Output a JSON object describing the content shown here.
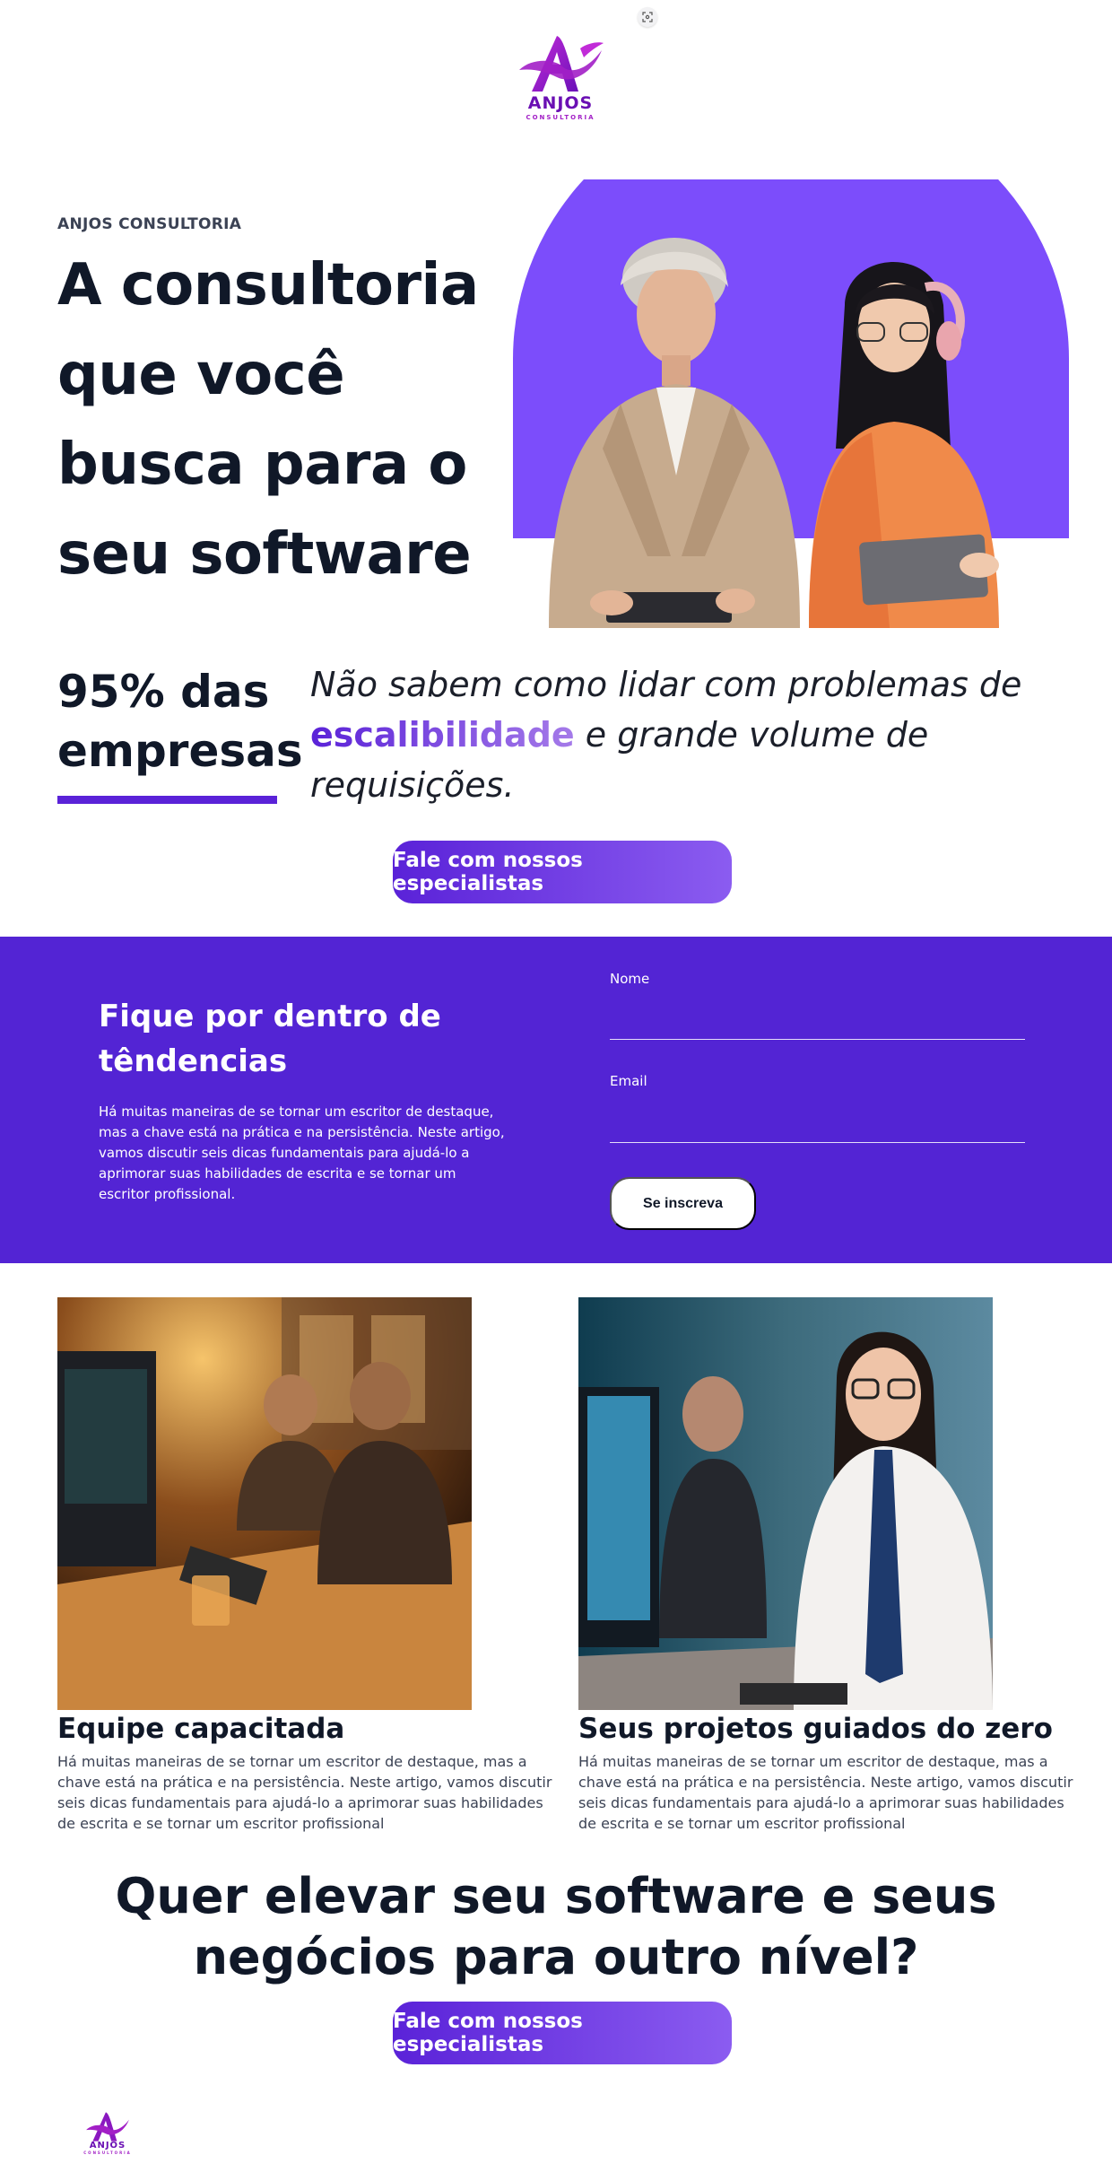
{
  "header": {
    "logo_word": "ANJOS",
    "logo_sub": "CONSULTORIA"
  },
  "hero": {
    "eyebrow": "ANJOS CONSULTORIA",
    "title_lines": [
      "A consultoria",
      "que você",
      "busca para o",
      "seu software"
    ]
  },
  "stat": {
    "line1": "95% das",
    "line2": "empresas",
    "quote_before": "Não sabem como lidar com problemas de ",
    "quote_highlight": "escalibilidade",
    "quote_after": " e grande volume de requisições."
  },
  "cta": {
    "label": "Fale com nossos especialistas"
  },
  "newsletter": {
    "title_line1": "Fique por dentro de",
    "title_line2": "têndencias",
    "description": "Há muitas maneiras de se tornar um escritor de destaque, mas a chave está na prática e na persistência. Neste artigo, vamos discutir seis dicas fundamentais para ajudá-lo a aprimorar suas habilidades de escrita e se tornar um escritor profissional.",
    "name_label": "Nome",
    "email_label": "Email",
    "name_value": "",
    "email_value": "",
    "submit_label": "Se inscreva"
  },
  "cards": [
    {
      "title": "Equipe capacitada",
      "description": "Há muitas maneiras de se tornar um escritor de destaque, mas a chave está na prática e na persistência. Neste artigo, vamos discutir seis dicas fundamentais para ajudá-lo a aprimorar suas habilidades de escrita e se tornar um escritor profissional"
    },
    {
      "title": "Seus projetos guiados do zero",
      "description": "Há muitas maneiras de se tornar um escritor de destaque, mas a chave está na prática e na persistência. Neste artigo, vamos discutir seis dicas fundamentais para ajudá-lo a aprimorar suas habilidades de escrita e se tornar um escritor profissional"
    }
  ],
  "final": {
    "title_line1": "Quer elevar seu software e seus",
    "title_line2": "negócios para outro nível?"
  },
  "colors": {
    "brand_purple": "#5324d4",
    "accent_violet": "#7b4be2",
    "hero_circle": "#7c4dfb",
    "text_dark": "#101828"
  }
}
